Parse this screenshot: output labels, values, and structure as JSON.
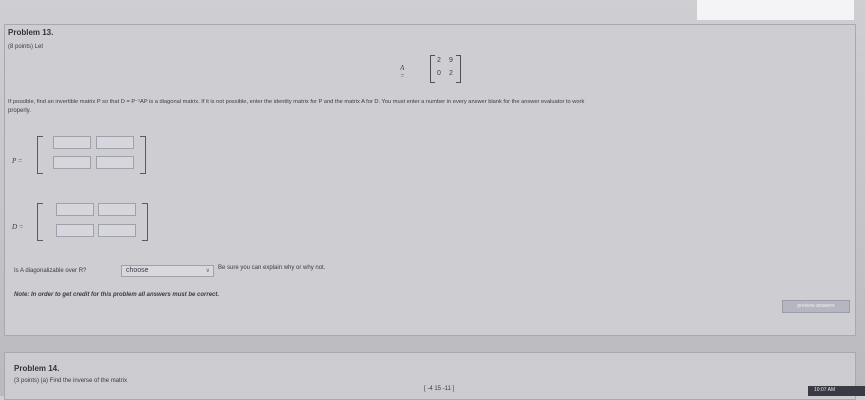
{
  "problem13": {
    "title": "Problem 13.",
    "points": "(8 points) Let",
    "matrix_label": "A =",
    "matrix": [
      [
        "2",
        "9"
      ],
      [
        "0",
        "2"
      ]
    ],
    "instruction": "If possible, find an invertible matrix P so that D = P⁻¹AP is a diagonal matrix. If it is not possible, enter the identity matrix for P and the matrix A for D. You must enter a number in every answer blank for the answer evaluator to work",
    "instruction_cont": "properly.",
    "p_label": "P =",
    "d_label": "D =",
    "p_values": [
      "",
      "",
      "",
      ""
    ],
    "d_values": [
      "",
      "",
      "",
      ""
    ],
    "diag_question": "Is A diagonalizable over R?",
    "diag_select_value": "choose",
    "diag_hint": "Be sure you can explain why or why not.",
    "note": "Note: In order to get credit for this problem all answers must be correct."
  },
  "preview_button": "preview answers",
  "problem14": {
    "title": "Problem 14.",
    "points": "(3 points) (a) Find the inverse of the matrix",
    "matrix_fragment": "[ -4  15  -11 ]"
  },
  "taskbar": {
    "clock": "10:07 AM"
  }
}
